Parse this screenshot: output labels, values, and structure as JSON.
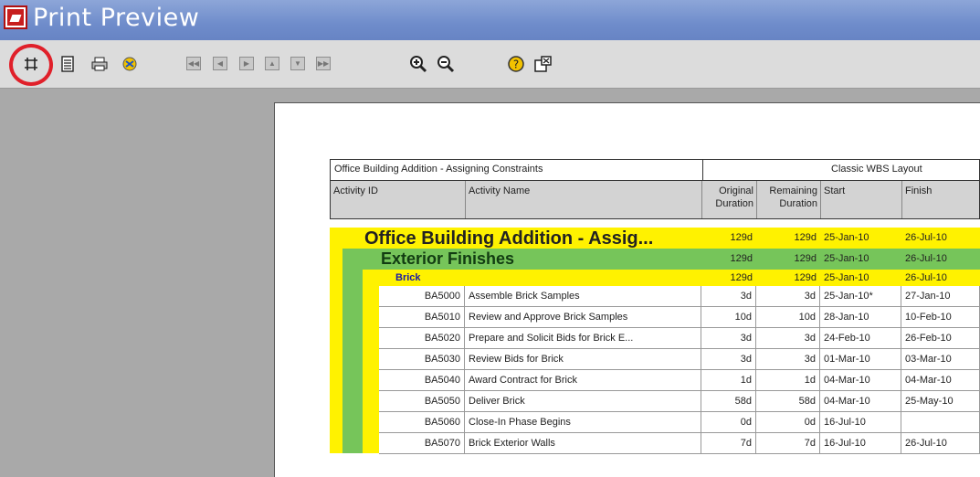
{
  "window": {
    "title": "Print Preview"
  },
  "toolbar": {
    "icons": [
      "page-setup-icon",
      "print-setup-icon",
      "print-icon",
      "print-options-icon",
      "first-page-icon",
      "previous-page-icon",
      "next-page-icon",
      "page-up-icon",
      "page-down-icon",
      "last-page-icon",
      "zoom-in-icon",
      "zoom-out-icon",
      "help-icon",
      "close-preview-icon"
    ],
    "highlight_color": "#e0202a"
  },
  "report": {
    "header_left": "Office Building Addition - Assigning Constraints",
    "header_right": "Classic WBS Layout",
    "columns": {
      "activity_id": "Activity ID",
      "activity_name": "Activity Name",
      "orig_dur_1": "Original",
      "orig_dur_2": "Duration",
      "rem_dur_1": "Remaining",
      "rem_dur_2": "Duration",
      "start": "Start",
      "finish": "Finish"
    },
    "groups": [
      {
        "name": "Office Building Addition - Assig...",
        "orig": "129d",
        "rem": "129d",
        "start": "25-Jan-10",
        "finish": "26-Jul-10"
      },
      {
        "name": "Exterior Finishes",
        "orig": "129d",
        "rem": "129d",
        "start": "25-Jan-10",
        "finish": "26-Jul-10"
      },
      {
        "name": "Brick",
        "orig": "129d",
        "rem": "129d",
        "start": "25-Jan-10",
        "finish": "26-Jul-10"
      }
    ],
    "activities": [
      {
        "id": "BA5000",
        "name": "Assemble Brick Samples",
        "orig": "3d",
        "rem": "3d",
        "start": "25-Jan-10*",
        "finish": "27-Jan-10"
      },
      {
        "id": "BA5010",
        "name": "Review and Approve Brick Samples",
        "orig": "10d",
        "rem": "10d",
        "start": "28-Jan-10",
        "finish": "10-Feb-10"
      },
      {
        "id": "BA5020",
        "name": "Prepare and Solicit Bids for Brick E...",
        "orig": "3d",
        "rem": "3d",
        "start": "24-Feb-10",
        "finish": "26-Feb-10"
      },
      {
        "id": "BA5030",
        "name": "Review Bids for Brick",
        "orig": "3d",
        "rem": "3d",
        "start": "01-Mar-10",
        "finish": "03-Mar-10"
      },
      {
        "id": "BA5040",
        "name": "Award Contract for Brick",
        "orig": "1d",
        "rem": "1d",
        "start": "04-Mar-10",
        "finish": "04-Mar-10"
      },
      {
        "id": "BA5050",
        "name": "Deliver Brick",
        "orig": "58d",
        "rem": "58d",
        "start": "04-Mar-10",
        "finish": "25-May-10"
      },
      {
        "id": "BA5060",
        "name": "Close-In Phase Begins",
        "orig": "0d",
        "rem": "0d",
        "start": "16-Jul-10",
        "finish": ""
      },
      {
        "id": "BA5070",
        "name": "Brick Exterior Walls",
        "orig": "7d",
        "rem": "7d",
        "start": "16-Jul-10",
        "finish": "26-Jul-10"
      }
    ],
    "colors": {
      "project_band": "#fff200",
      "wbs_band": "#76c55a",
      "group_text": "#1a1aa6"
    }
  }
}
